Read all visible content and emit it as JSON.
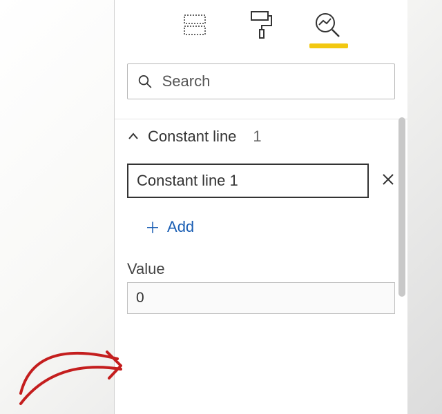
{
  "search": {
    "placeholder": "Search",
    "value": ""
  },
  "section": {
    "title": "Constant line",
    "count": "1"
  },
  "item": {
    "name": "Constant line 1"
  },
  "add": {
    "label": "Add"
  },
  "valueField": {
    "label": "Value",
    "value": "0"
  }
}
